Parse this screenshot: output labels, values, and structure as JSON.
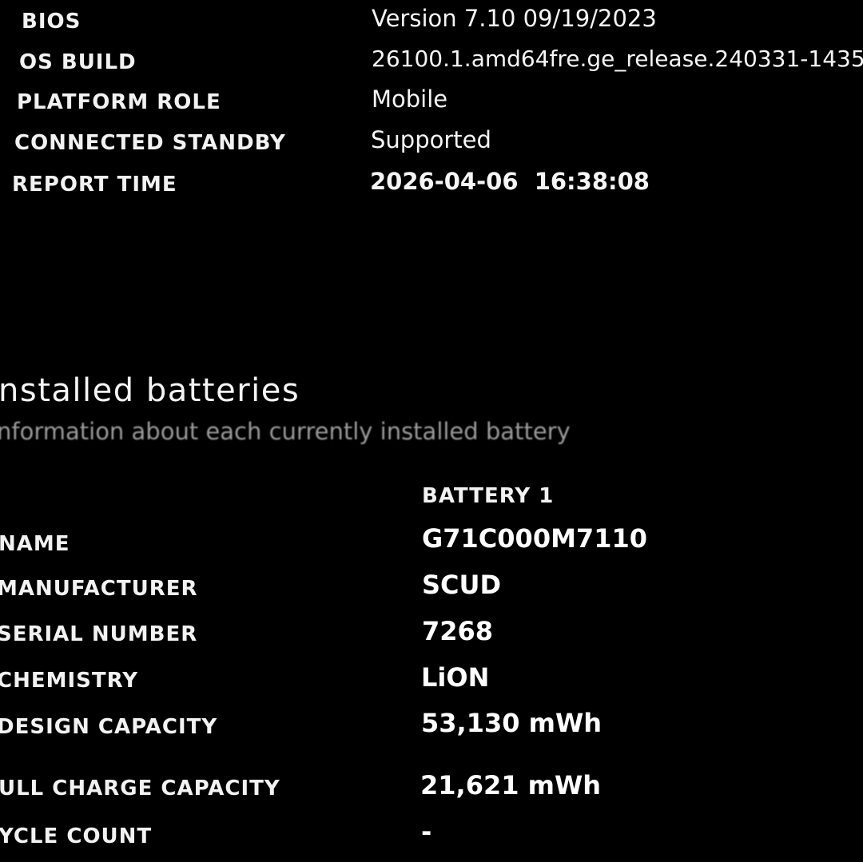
{
  "system_info": {
    "rows": [
      {
        "label": "BIOS",
        "value": "Version 7.10 09/19/2023"
      },
      {
        "label": "OS BUILD",
        "value": "26100.1.amd64fre.ge_release.240331-1435"
      },
      {
        "label": "PLATFORM ROLE",
        "value": "Mobile"
      },
      {
        "label": "CONNECTED STANDBY",
        "value": "Supported"
      },
      {
        "label": "REPORT TIME",
        "value": "2026-04-06  16:38:08"
      }
    ]
  },
  "installed_batteries": {
    "title": "nstalled batteries",
    "subtitle": "nformation about each currently installed battery",
    "column_header": "BATTERY 1",
    "rows": [
      {
        "label": "NAME",
        "value": "G71C000M7110"
      },
      {
        "label": "MANUFACTURER",
        "value": "SCUD"
      },
      {
        "label": "SERIAL NUMBER",
        "value": "7268"
      },
      {
        "label": "CHEMISTRY",
        "value": "LiON"
      },
      {
        "label": "DESIGN CAPACITY",
        "value": "53,130 mWh"
      },
      {
        "label": "ULL CHARGE CAPACITY",
        "value": "21,621 mWh"
      },
      {
        "label": "YCLE COUNT",
        "value": "-"
      }
    ]
  }
}
